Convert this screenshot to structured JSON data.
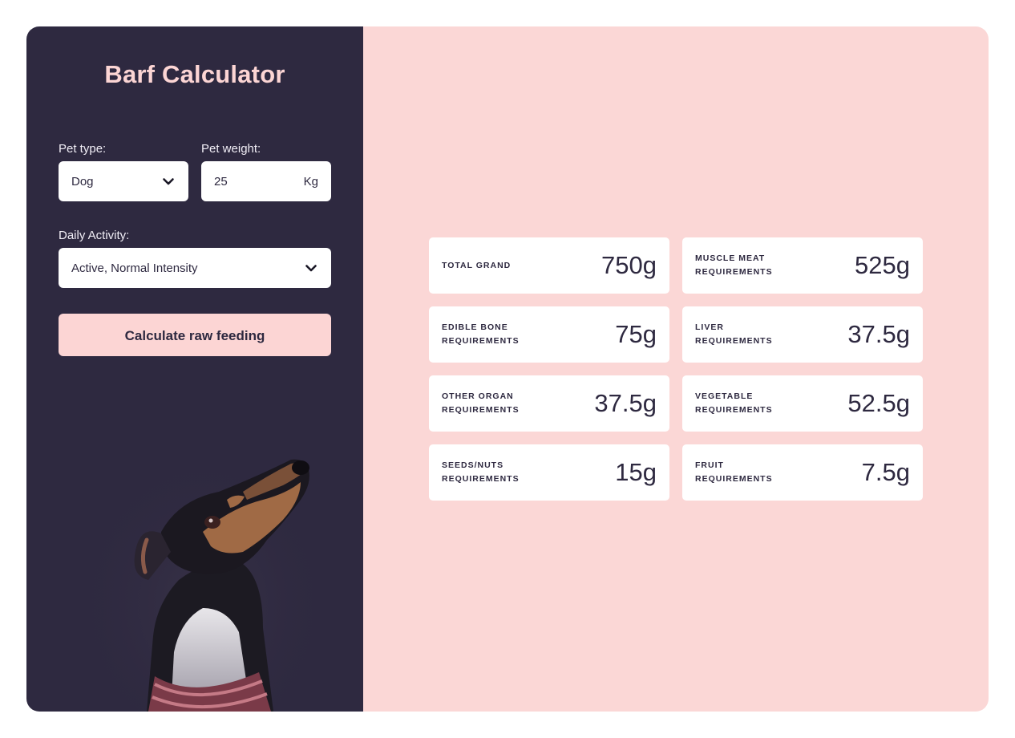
{
  "app": {
    "title": "Barf Calculator"
  },
  "form": {
    "pet_type_label": "Pet type:",
    "pet_type_value": "Dog",
    "pet_weight_label": "Pet weight:",
    "pet_weight_value": "25",
    "pet_weight_unit": "Kg",
    "activity_label": "Daily Activity:",
    "activity_value": "Active, Normal Intensity",
    "calculate_label": "Calculate raw feeding"
  },
  "results": [
    {
      "label": "TOTAL GRAND",
      "value": "750g"
    },
    {
      "label": "MUSCLE MEAT\nREQUIREMENTS",
      "value": "525g"
    },
    {
      "label": "EDIBLE BONE\nREQUIREMENTS",
      "value": "75g"
    },
    {
      "label": "LIVER\nREQUIREMENTS",
      "value": "37.5g"
    },
    {
      "label": "OTHER ORGAN\nREQUIREMENTS",
      "value": "37.5g"
    },
    {
      "label": "VEGETABLE\nREQUIREMENTS",
      "value": "52.5g"
    },
    {
      "label": "SEEDS/NUTS\nREQUIREMENTS",
      "value": "15g"
    },
    {
      "label": "FRUIT\nREQUIREMENTS",
      "value": "7.5g"
    }
  ],
  "colors": {
    "sidebar_bg": "#2e2940",
    "main_bg": "#fbd7d6",
    "accent": "#fcd5d4",
    "card_bg": "#ffffff"
  },
  "icons": {
    "dropdown": "chevron-down-icon",
    "photo": "dog-photo"
  }
}
